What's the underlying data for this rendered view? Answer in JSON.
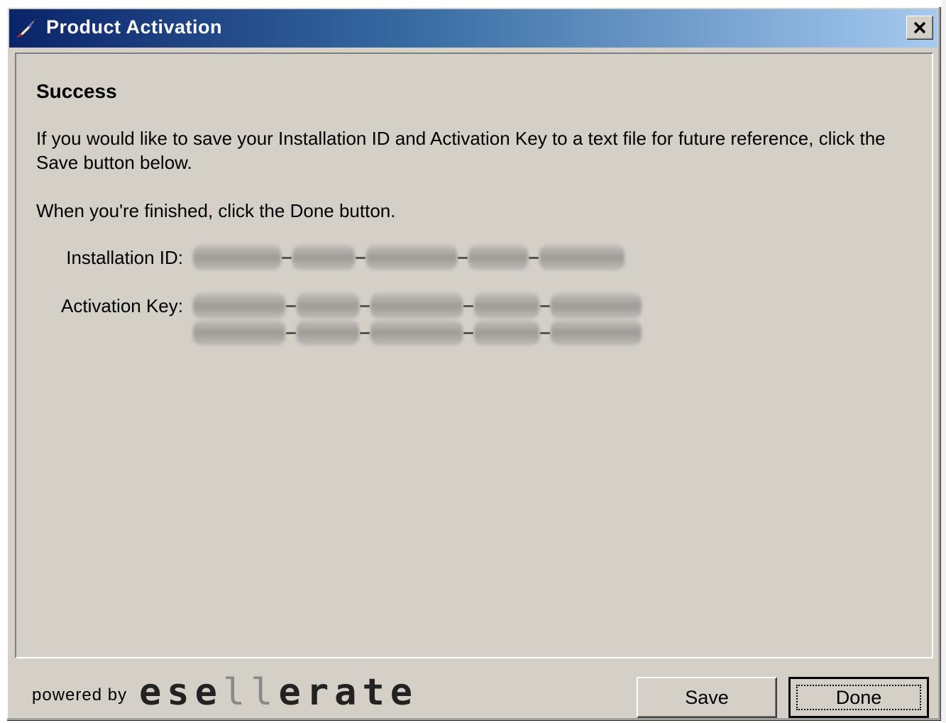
{
  "window": {
    "title": "Product Activation",
    "close_label": "×"
  },
  "content": {
    "heading": "Success",
    "paragraph1": "If you would like to save your Installation ID and Activation Key to a text file for future reference, click the Save button below.",
    "paragraph2": "When you're finished, click the Done button.",
    "installation_id_label": "Installation ID:",
    "activation_key_label": "Activation Key:"
  },
  "footer": {
    "powered_by": "powered by",
    "brand_part1": "ese",
    "brand_part2": "ll",
    "brand_part3": "erate",
    "save_label": "Save",
    "done_label": "Done"
  },
  "colors": {
    "titlebar_start": "#0a246a",
    "titlebar_end": "#a6caf0",
    "dialog_face": "#d4d0c8"
  }
}
